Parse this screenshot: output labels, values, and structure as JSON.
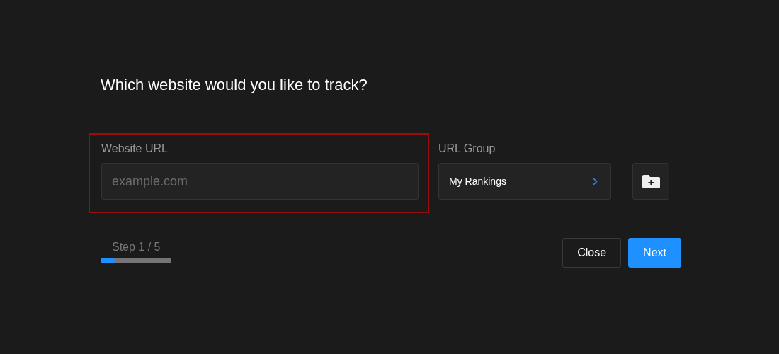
{
  "title": "Which website would you like to track?",
  "website_url": {
    "label": "Website URL",
    "placeholder": "example.com",
    "highlighted": true
  },
  "url_group": {
    "label": "URL Group",
    "value": "My Rankings"
  },
  "step": {
    "text": "Step 1 / 5",
    "level": 0.2
  },
  "buttons": [
    {
      "label": "Close",
      "kind": "secondary"
    },
    {
      "label": "Next",
      "kind": "primary"
    }
  ]
}
